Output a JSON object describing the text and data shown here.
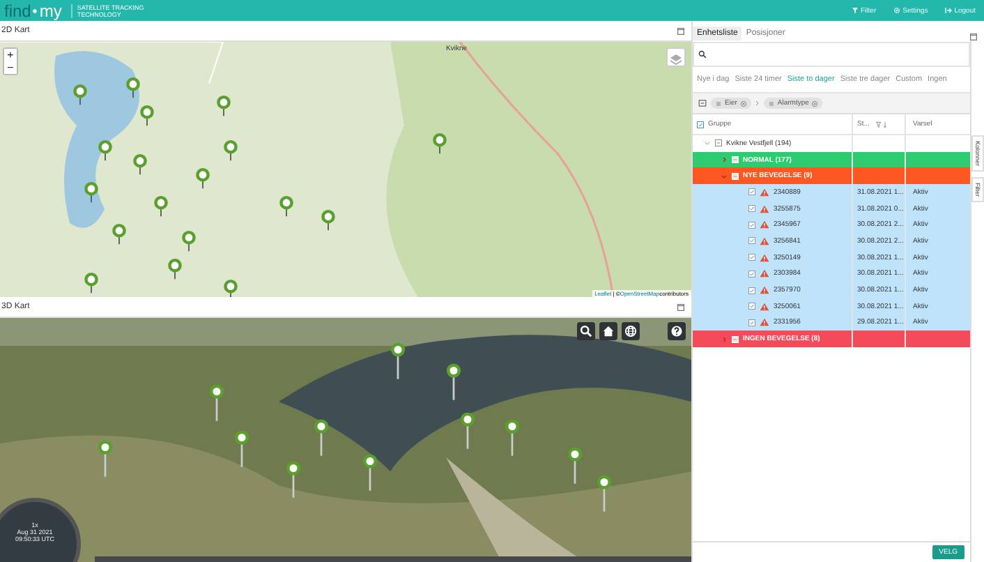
{
  "header": {
    "logo_left": "find",
    "logo_right": "my",
    "tagline": "SATELLITE TRACKING TECHNOLOGY",
    "actions": [
      {
        "kind": "filter",
        "label": "Filter"
      },
      {
        "kind": "settings",
        "label": "Settings"
      },
      {
        "kind": "logout",
        "label": "Logout"
      }
    ]
  },
  "map_2d": {
    "title": "2D Kart",
    "zoom_in": "+",
    "zoom_out": "−",
    "attribution_link": "Leaflet",
    "attribution_text": "| © ",
    "osm_link": "OpenStreetMap",
    "attribution_tail": " contributors",
    "place_label": "Kvikne"
  },
  "map_3d": {
    "title": "3D Kart",
    "speed": "1x",
    "date": "Aug 31 2021",
    "time": "09:50:33 UTC"
  },
  "panel": {
    "tabs": [
      {
        "label": "Enhetsliste",
        "selected": true
      },
      {
        "label": "Posisjoner",
        "selected": false
      }
    ],
    "periods": [
      {
        "label": "Nye i dag",
        "selected": false
      },
      {
        "label": "Siste 24 timer",
        "selected": false
      },
      {
        "label": "Siste to dager",
        "selected": true
      },
      {
        "label": "Siste tre dager",
        "selected": false
      },
      {
        "label": "Custom",
        "selected": false
      },
      {
        "label": "Ingen",
        "selected": false
      }
    ],
    "group_chips": [
      "Eier",
      "Alarmtype"
    ],
    "columns": [
      "Gruppe",
      "St...",
      "Varsel"
    ],
    "root": {
      "label": "Kvikne Vestfjell (194)",
      "expanded": true
    },
    "groups": [
      {
        "label": "NORMAL (177)",
        "color": "#2ecc71",
        "expanded": false
      },
      {
        "label": "NYE BEVEGELSE (9)",
        "color": "#ff5722",
        "expanded": true,
        "rows": [
          {
            "id": "2340889",
            "time": "31.08.2021 1...",
            "status": "Aktiv",
            "checked": true
          },
          {
            "id": "3255875",
            "time": "31.08.2021 0...",
            "status": "Aktiv",
            "checked": true
          },
          {
            "id": "2345967",
            "time": "30.08.2021 2...",
            "status": "Aktiv",
            "checked": true
          },
          {
            "id": "3256841",
            "time": "30.08.2021 2...",
            "status": "Aktiv",
            "checked": true
          },
          {
            "id": "3250149",
            "time": "30.08.2021 1...",
            "status": "Aktiv",
            "checked": true
          },
          {
            "id": "2303984",
            "time": "30.08.2021 1...",
            "status": "Aktiv",
            "checked": true
          },
          {
            "id": "2357970",
            "time": "30.08.2021 1...",
            "status": "Aktiv",
            "checked": true
          },
          {
            "id": "3250061",
            "time": "30.08.2021 1...",
            "status": "Aktiv",
            "checked": true
          },
          {
            "id": "2331956",
            "time": "29.08.2021 1...",
            "status": "Aktiv",
            "checked": true
          }
        ]
      },
      {
        "label": "INGEN BEVEGELSE (8)",
        "color": "#f44b5a",
        "expanded": false
      }
    ],
    "side_tabs": [
      "Kolonner",
      "Filter"
    ],
    "select_button": "VELG"
  }
}
